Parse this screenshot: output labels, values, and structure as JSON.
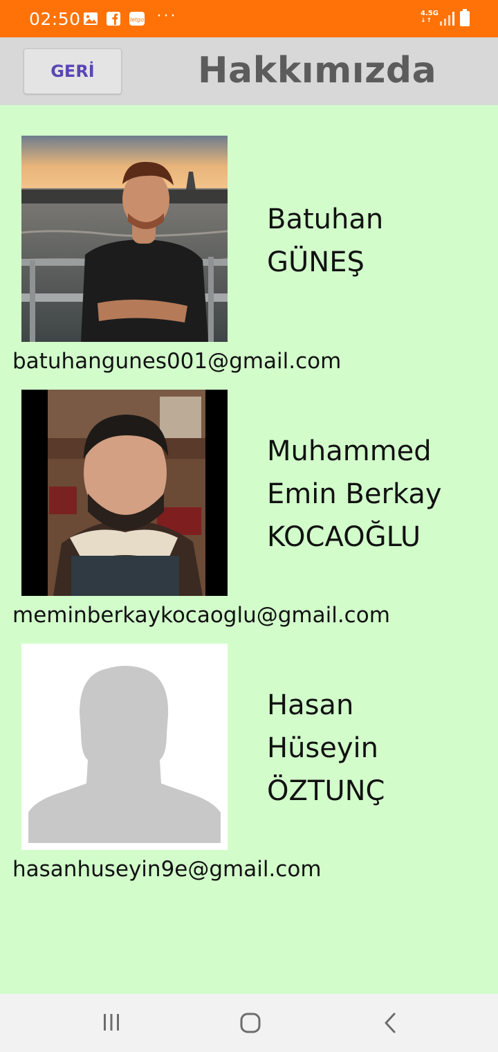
{
  "status_bar": {
    "time": "02:50",
    "notification_icons": [
      "gallery-icon",
      "facebook-icon",
      "letgo-icon"
    ],
    "more_indicator": "···",
    "network_type": "4.5G",
    "background_color": "#ff7207"
  },
  "header": {
    "back_label": "GERİ",
    "title": "Hakkımızda",
    "background_color": "#d8d8d8"
  },
  "members": [
    {
      "name_lines": [
        "Batuhan",
        "GÜNEŞ"
      ],
      "email": "batuhangunes001@gmail.com",
      "photo": "portrait-photo-sunset"
    },
    {
      "name_lines": [
        "Muhammed",
        "Emin Berkay",
        "KOCAOĞLU"
      ],
      "email": "meminberkaykocaoglu@gmail.com",
      "photo": "portrait-photo-indoor"
    },
    {
      "name_lines": [
        "Hasan",
        "Hüseyin",
        "ÖZTUNÇ"
      ],
      "email": "hasanhuseyin9e@gmail.com",
      "photo": "placeholder-silhouette"
    }
  ],
  "nav_bar": {
    "buttons": [
      "recent-apps-icon",
      "home-icon",
      "back-icon"
    ]
  },
  "colors": {
    "page_background": "#d2fdcb",
    "back_label_color": "#5a46b6",
    "title_color": "#5c5c5c"
  }
}
